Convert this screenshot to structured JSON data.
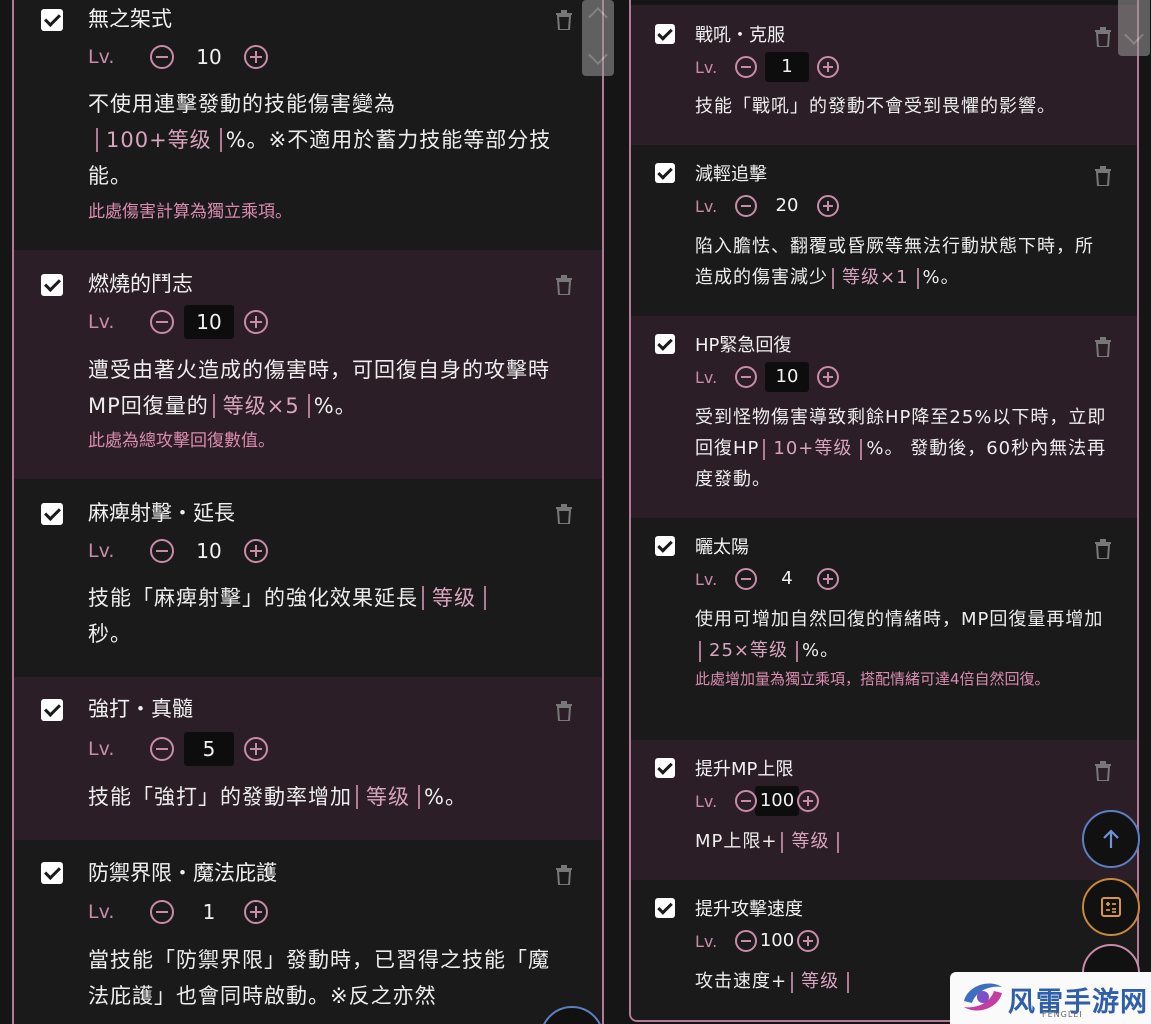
{
  "left_skills": [
    {
      "checked": true,
      "title": "無之架式",
      "lv_label": "Lv.",
      "level": "10",
      "desc_before": "不使用連擊發動的技能傷害變為",
      "desc_hl": "100+等级",
      "desc_after": "%。※不適用於蓄力技能等部分技能。",
      "note": "此處傷害計算為獨立乘項。"
    },
    {
      "checked": true,
      "title": "燃燒的鬥志",
      "lv_label": "Lv.",
      "level": "10",
      "desc_before": "遭受由著火造成的傷害時，可回復自身的攻擊時MP回復量的",
      "desc_hl": "等级×5",
      "desc_after": "%。",
      "note": "此處為總攻擊回復數值。"
    },
    {
      "checked": true,
      "title": "麻痺射擊・延長",
      "lv_label": "Lv.",
      "level": "10",
      "desc_before": "技能「麻痺射擊」的強化效果延長",
      "desc_hl": "等级",
      "desc_after": "秒。",
      "note": ""
    },
    {
      "checked": true,
      "title": "強打・真髓",
      "lv_label": "Lv.",
      "level": "5",
      "desc_before": "技能「強打」的發動率增加",
      "desc_hl": "等级",
      "desc_after": "%。",
      "note": ""
    },
    {
      "checked": true,
      "title": "防禦界限・魔法庇護",
      "lv_label": "Lv.",
      "level": "1",
      "desc_before": "當技能「防禦界限」發動時，已習得之技能「魔法庇護」也會同時啟動。※反之亦然",
      "desc_hl": "",
      "desc_after": "",
      "note": ""
    }
  ],
  "right_skills": [
    {
      "checked": true,
      "title": "戰吼・克服",
      "lv_label": "Lv.",
      "level": "1",
      "desc_before": "技能「戰吼」的發動不會受到畏懼的影響。",
      "desc_hl": "",
      "desc_after": "",
      "note": ""
    },
    {
      "checked": true,
      "title": "減輕追擊",
      "lv_label": "Lv.",
      "level": "20",
      "desc_before": "陷入膽怯、翻覆或昏厥等無法行動狀態下時，所造成的傷害減少",
      "desc_hl": "等级×1",
      "desc_after": "%。",
      "note": ""
    },
    {
      "checked": true,
      "title": "HP緊急回復",
      "lv_label": "Lv.",
      "level": "10",
      "desc_before": "受到怪物傷害導致剩餘HP降至25%以下時，立即回復HP",
      "desc_hl": "10+等级",
      "desc_after": "%。 發動後，60秒內無法再度發動。",
      "note": ""
    },
    {
      "checked": true,
      "title": "曬太陽",
      "lv_label": "Lv.",
      "level": "4",
      "desc_before": "使用可增加自然回復的情緒時，MP回復量再增加",
      "desc_hl": "25×等级",
      "desc_after": "%。",
      "note": "此處增加量為獨立乘項，搭配情緒可達4倍自然回復。"
    },
    {
      "checked": true,
      "title": "提升MP上限",
      "lv_label": "Lv.",
      "level": "100",
      "desc_before": "MP上限+",
      "desc_hl": "等级",
      "desc_after": "",
      "note": ""
    },
    {
      "checked": true,
      "title": "提升攻擊速度",
      "lv_label": "Lv.",
      "level": "100",
      "desc_before": "攻击速度+",
      "desc_hl": "等级",
      "desc_after": "",
      "note": ""
    }
  ],
  "watermark": {
    "text": "风雷手游网",
    "sub": "FENGLEI"
  },
  "colors": {
    "accent": "#b27a94",
    "accent_text": "#c98ba9",
    "card_dark": "#1a1a1a",
    "card_tint": "#2b1e26",
    "fab_blue": "#5c7fc2",
    "fab_orange": "#c7893c"
  },
  "icons": {
    "checkbox": "checkbox-checked-icon",
    "delete": "trash-icon",
    "decrease": "minus-circle-icon",
    "increase": "plus-circle-icon",
    "scroll_top": "arrow-up-icon",
    "calculator": "calculator-icon"
  }
}
